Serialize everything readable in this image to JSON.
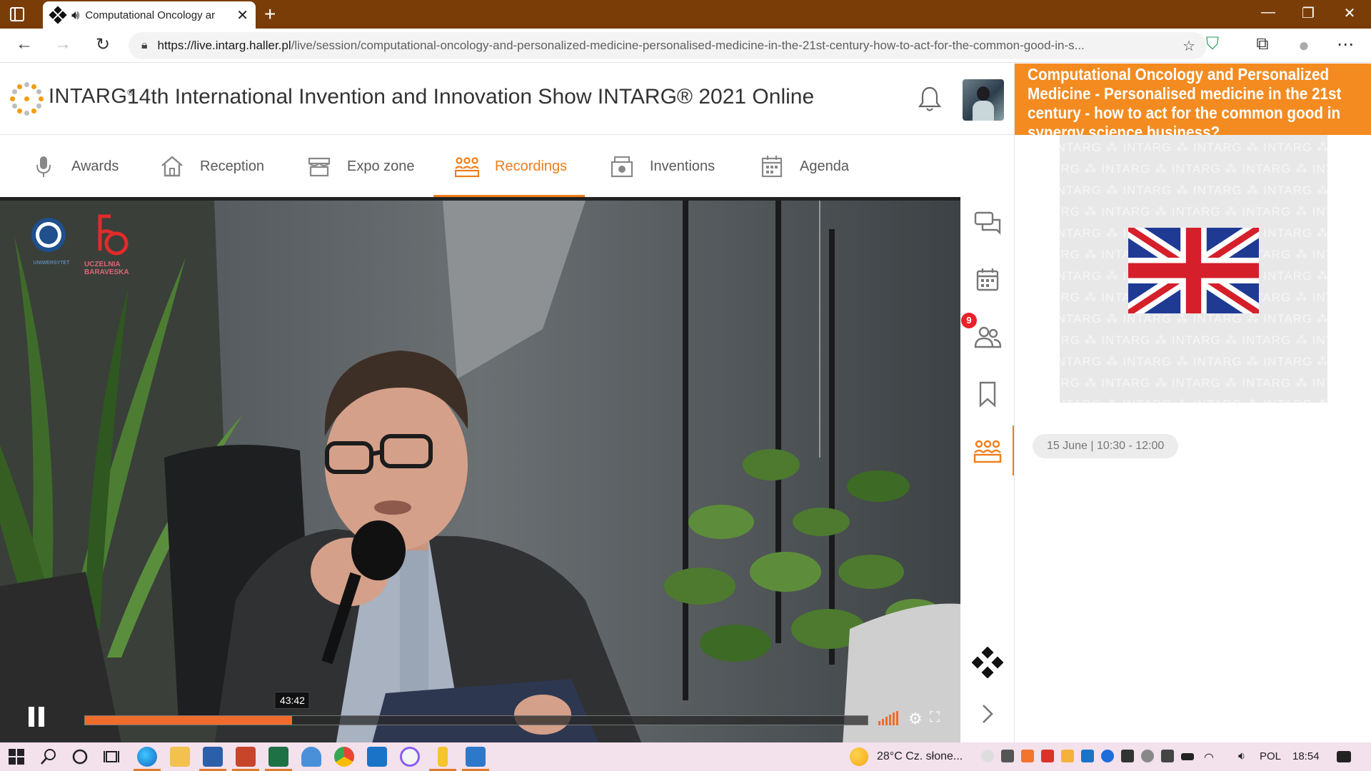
{
  "browser": {
    "tab_title": "Computational Oncology ar",
    "tab_close": "✕",
    "new_tab": "+",
    "url_host": "https://live.intarg.haller.pl",
    "url_path": "/live/session/computational-oncology-and-personalized-medicine-personalised-medicine-in-the-21st-century-how-to-act-for-the-common-good-in-s...",
    "window_controls": [
      "—",
      "❐",
      "✕"
    ]
  },
  "header": {
    "logo_text": "INTARG",
    "logo_reg": "®",
    "event_title": "14th International Invention and Innovation Show INTARG® 2021 Online"
  },
  "nav": {
    "items": [
      {
        "label": "Awards",
        "icon": "microphone-icon"
      },
      {
        "label": "Reception",
        "icon": "home-icon"
      },
      {
        "label": "Expo zone",
        "icon": "booth-icon"
      },
      {
        "label": "Recordings",
        "icon": "audience-icon",
        "active": true
      },
      {
        "label": "Inventions",
        "icon": "inventions-icon"
      },
      {
        "label": "Agenda",
        "icon": "calendar-icon"
      }
    ]
  },
  "video": {
    "time_tooltip": "43:42",
    "progress_fraction": 0.265,
    "logo_caption": "UCZELNIA BARAVESKA",
    "university_caption": "UNIWERSYTET"
  },
  "rail": {
    "badge_count": "9",
    "icons": [
      "chat-icon",
      "calendar-icon",
      "people-icon",
      "bookmark-icon",
      "recordings-icon",
      "app-logo-icon",
      "chevron-right-icon"
    ]
  },
  "session": {
    "title": "Computational Oncology and Personalized Medicine - Personalised medicine in the 21st century - how to act for the common good in synergy science business?",
    "watermark": "INTARG",
    "time": "15 June | 10:30 - 12:00"
  },
  "taskbar": {
    "weather": "28°C  Cz. słone...",
    "language": "POL",
    "clock": "18:54"
  },
  "colors": {
    "accent": "#ef7d1b",
    "title_bar": "#7a3d07",
    "badge": "#e8222a",
    "progress": "#ef6c2c"
  }
}
